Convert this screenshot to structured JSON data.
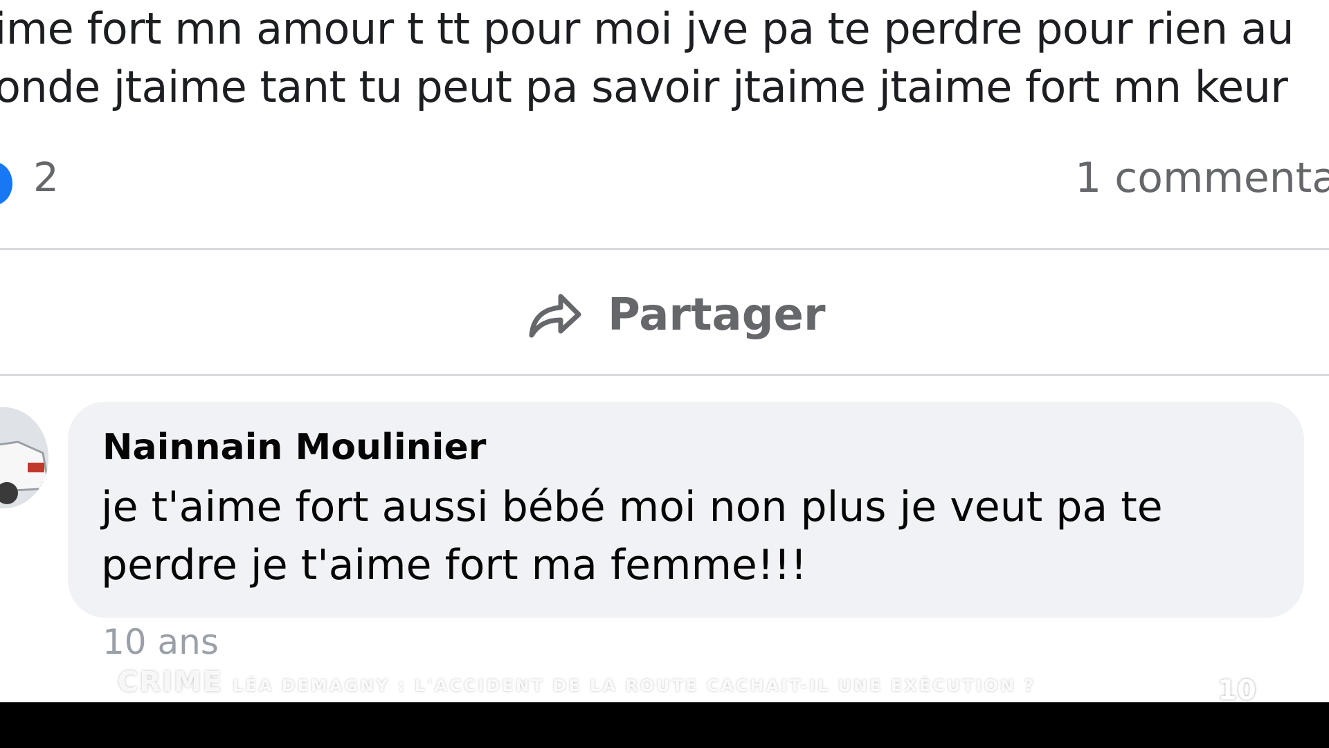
{
  "post": {
    "text_lines": [
      "ime fort mn amour t tt pour moi jve pa te perdre pour rien au",
      "onde jtaime tant tu peut pa savoir jtaime jtaime fort mn keur"
    ],
    "reaction_count": "2",
    "comment_count": "1 commenta",
    "share_label": "Partager"
  },
  "comment": {
    "author": "Nainnain Moulinier",
    "text_lines": [
      "je t'aime fort aussi bébé moi non plus je veut pa te",
      "perdre je t'aime fort ma femme!!!"
    ],
    "time": "10 ans"
  },
  "overlay": {
    "brand": "CRIME",
    "headline": "LÉA DEMAGNY : L'ACCIDENT DE LA ROUTE CACHAIT-IL UNE EXÉCUTION ?",
    "channel_logo": "10"
  },
  "colors": {
    "reaction_blue": "#1877f2",
    "secondary_text": "#65676b",
    "comment_bubble": "#f0f2f5"
  },
  "icons": {
    "reaction": "like-reaction-icon",
    "share": "share-arrow-icon"
  }
}
